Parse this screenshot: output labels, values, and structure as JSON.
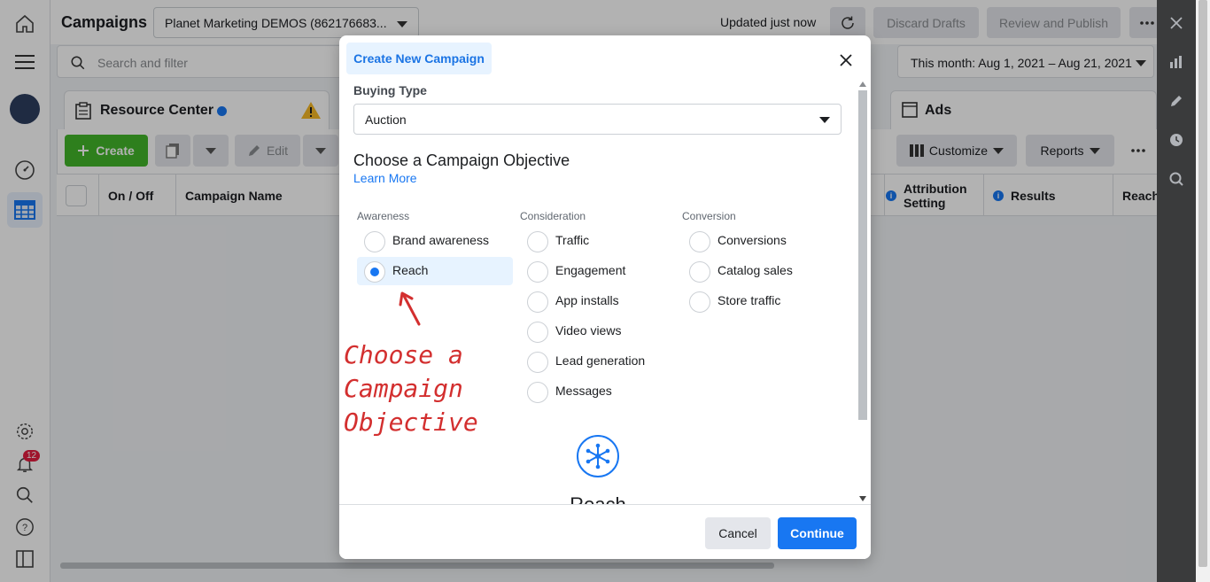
{
  "header": {
    "title": "Campaigns",
    "account": "Planet Marketing DEMOS (862176683...",
    "updated": "Updated just now",
    "discard_label": "Discard Drafts",
    "review_label": "Review and Publish"
  },
  "search": {
    "placeholder": "Search and filter",
    "date_range": "This month: Aug 1, 2021 – Aug 21, 2021"
  },
  "tabs": {
    "resource_center": "Resource Center",
    "ads": "Ads"
  },
  "toolbar": {
    "create": "Create",
    "edit": "Edit",
    "customize": "Customize",
    "reports": "Reports"
  },
  "table": {
    "columns": [
      "On / Off",
      "Campaign Name",
      "Attribution Setting",
      "Results",
      "Reach"
    ]
  },
  "rail": {
    "notification_count": "12"
  },
  "modal": {
    "tab_label": "Create New Campaign",
    "buying_type_label": "Buying Type",
    "buying_type_value": "Auction",
    "objective_title": "Choose a Campaign Objective",
    "learn_more": "Learn More",
    "columns": [
      {
        "title": "Awareness",
        "options": [
          "Brand awareness",
          "Reach"
        ]
      },
      {
        "title": "Consideration",
        "options": [
          "Traffic",
          "Engagement",
          "App installs",
          "Video views",
          "Lead generation",
          "Messages"
        ]
      },
      {
        "title": "Conversion",
        "options": [
          "Conversions",
          "Catalog sales",
          "Store traffic"
        ]
      }
    ],
    "selected": "Reach",
    "preview_title": "Reach",
    "cancel": "Cancel",
    "continue": "Continue"
  },
  "annotation": {
    "lines": [
      "Choose a",
      "Campaign",
      "Objective"
    ],
    "color": "#d32f2f"
  },
  "colors": {
    "accent": "#1877f2",
    "create_green": "#42b72a"
  }
}
